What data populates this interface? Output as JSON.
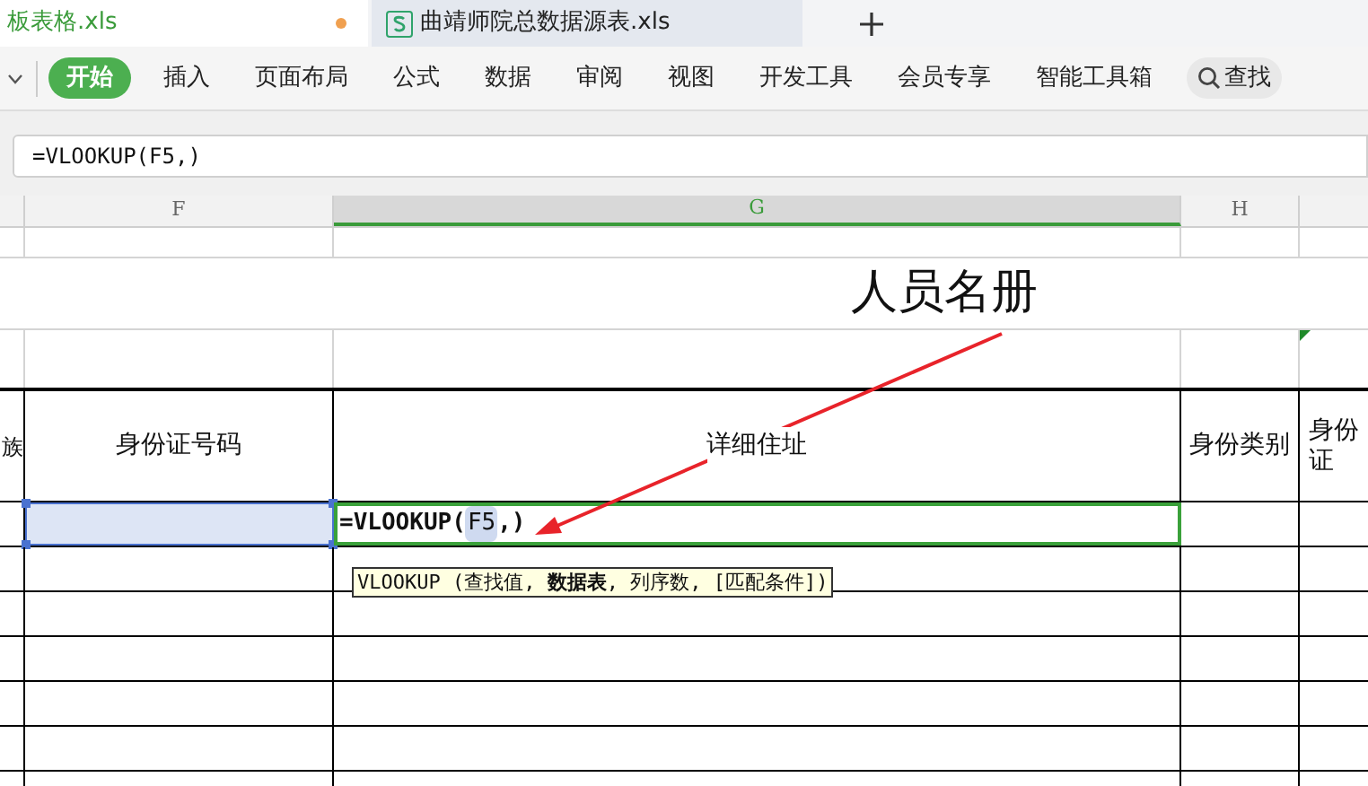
{
  "tabs": [
    {
      "label": "板表格.xls",
      "selected": true,
      "modified": true
    },
    {
      "label": "曲靖师院总数据源表.xls",
      "selected": false,
      "modified": false
    }
  ],
  "ribbon": {
    "items": [
      {
        "label": "开始",
        "selected": true
      },
      {
        "label": "插入",
        "selected": false
      },
      {
        "label": "页面布局",
        "selected": false
      },
      {
        "label": "公式",
        "selected": false
      },
      {
        "label": "数据",
        "selected": false
      },
      {
        "label": "审阅",
        "selected": false
      },
      {
        "label": "视图",
        "selected": false
      },
      {
        "label": "开发工具",
        "selected": false
      },
      {
        "label": "会员专享",
        "selected": false
      },
      {
        "label": "智能工具箱",
        "selected": false
      }
    ],
    "search": "查找"
  },
  "formula_bar": {
    "value": "=VLOOKUP(F5,)"
  },
  "columns": [
    {
      "label": "F",
      "selected": false
    },
    {
      "label": "G",
      "selected": true
    },
    {
      "label": "H",
      "selected": false
    }
  ],
  "sheet": {
    "title": "人员名册",
    "headers": [
      "族",
      "身份证号码",
      "详细住址",
      "身份类别",
      "身份证"
    ],
    "editing": {
      "prefix": "=VLOOKUP(",
      "reference": "F5",
      "suffix": ",)"
    },
    "tooltip": "VLOOKUP (查找值, **数据表**, 列序数, [匹配条件])"
  }
}
